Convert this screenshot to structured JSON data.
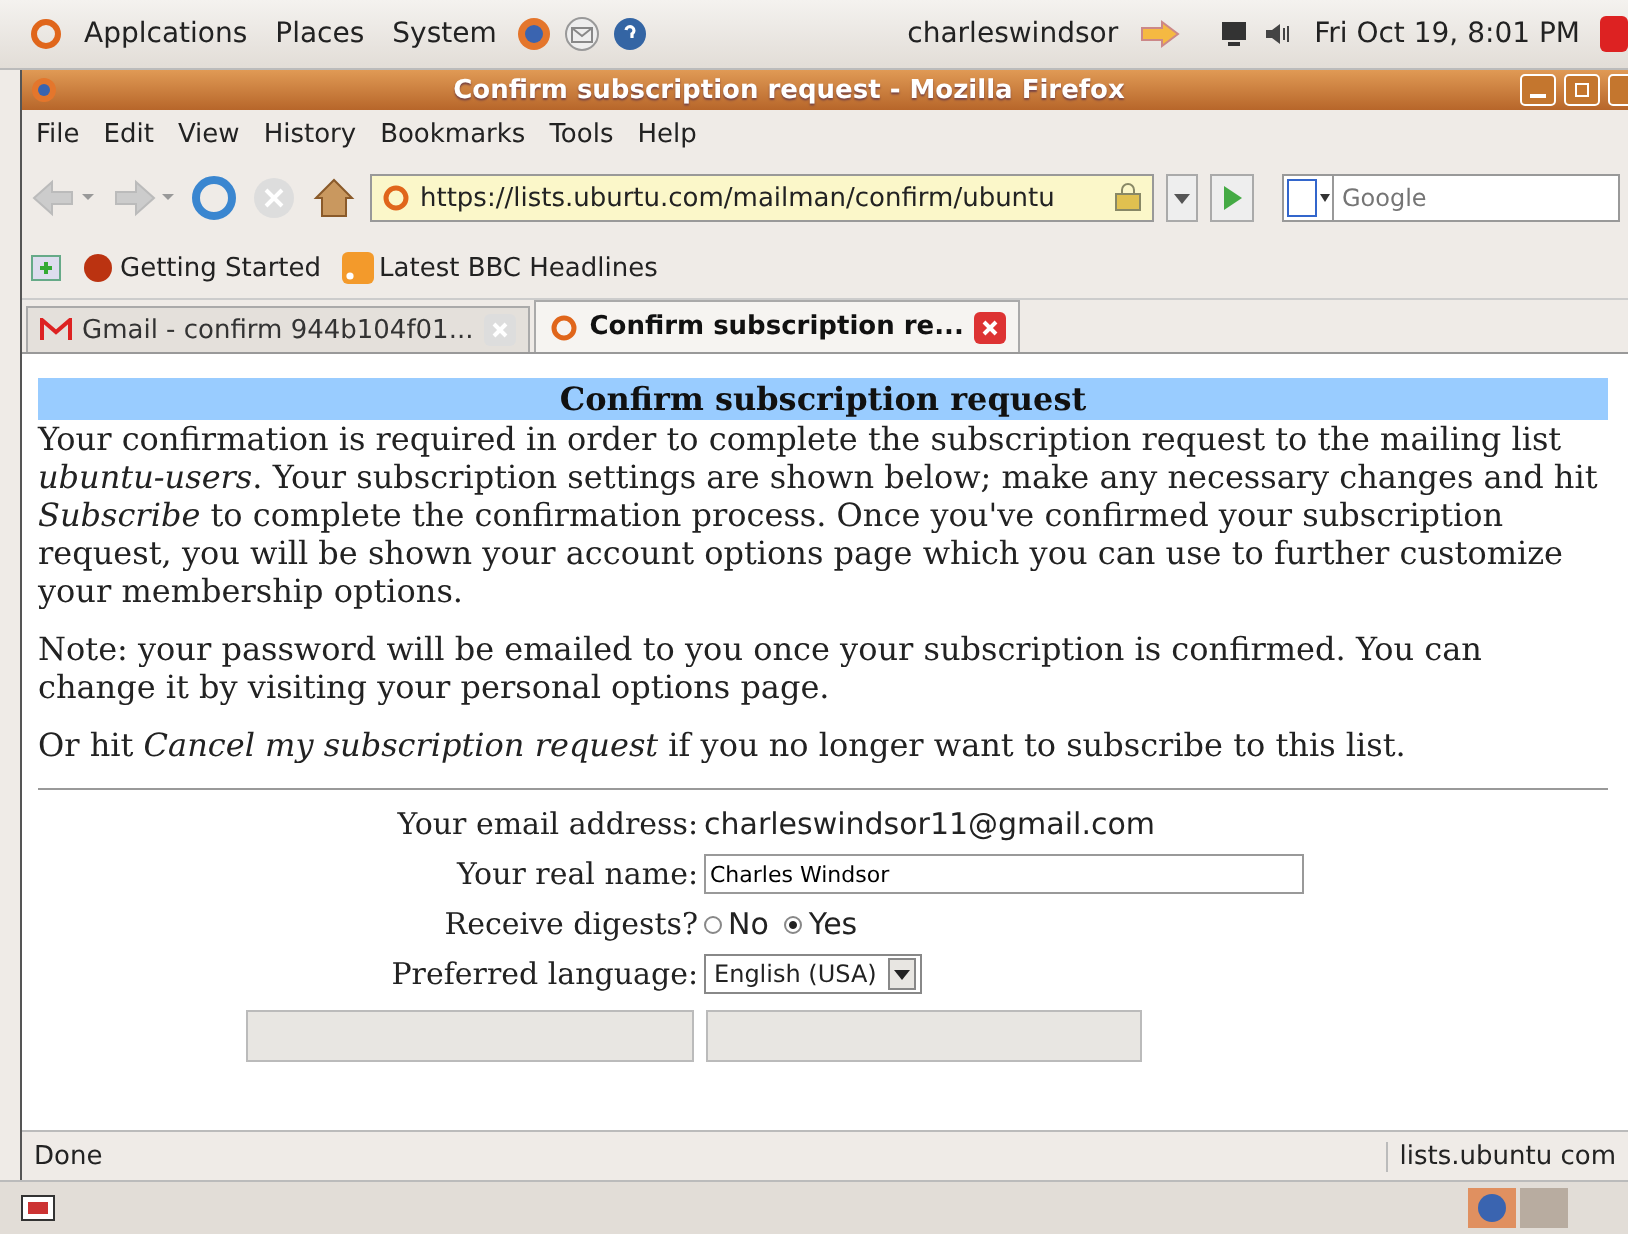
{
  "top_panel": {
    "menus": [
      "Applcations",
      "Places",
      "System"
    ],
    "user": "charleswindsor",
    "clock": "Fri Oct 19,  8:01 PM"
  },
  "window": {
    "title": "Confirm subscription request - Mozilla Firefox"
  },
  "menu_bar": [
    "File",
    "Edit",
    "View",
    "History",
    "Bookmarks",
    "Tools",
    "Help"
  ],
  "nav": {
    "url": "https://lists.uburtu.com/mailman/confirm/ubuntu",
    "search": {
      "placeholder": "Google"
    }
  },
  "bookmarks": [
    "Getting Started",
    "Latest BBC Headlines"
  ],
  "tabs": [
    {
      "label": "Gmail - confirm 944b104f01...",
      "selected": false
    },
    {
      "label": "Confirm subscription re...",
      "selected": true
    }
  ],
  "page": {
    "heading": "Confirm subscription request",
    "paragraphs": [
      "Your confirmation is required in order to complete the subscription request to the mailing list *ubuntu-users*. Your subscription settings are shown below; make any necessary changes and hit *Subscribe* to complete the confirmation process. Once you've confirmed your subscription request, you will be shown your account options page which you can use to further customize your membership options.",
      "Note: your password will be emailed to you once your subscription is confirmed. You can change it by visiting your personal options page.",
      "Or hit *Cancel my subscription request* if you no longer want to subscribe to this list."
    ],
    "form": [
      {
        "kind": "text",
        "label": "Your email address:",
        "value": "charleswindsor11@gmail.com"
      },
      {
        "kind": "input",
        "label": "Your real name:",
        "value": "Charles Windsor"
      },
      {
        "kind": "radio",
        "label": "Receive digests?",
        "options": [
          {
            "label": "No",
            "selected": false
          },
          {
            "label": "Yes",
            "selected": true
          }
        ]
      },
      {
        "kind": "select",
        "label": "Preferred language:",
        "value": "English (USA)"
      }
    ]
  },
  "status_bar": {
    "text": "Done",
    "host": "lists.ubuntu com"
  }
}
